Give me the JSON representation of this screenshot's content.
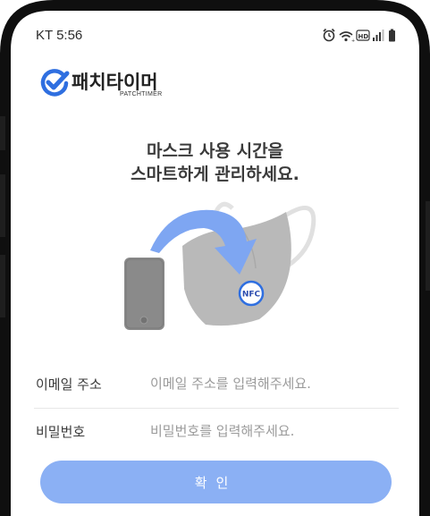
{
  "status_bar": {
    "time": "KT 5:56",
    "icons": [
      "alarm-icon",
      "wifi-icon",
      "hd-icon",
      "signal-icon",
      "battery-icon"
    ],
    "hd_text": "HD"
  },
  "brand": {
    "name": "패치타이머",
    "subtitle": "PATCHTIMER",
    "accent_color": "#2f6fe0"
  },
  "headline": {
    "line1": "마스크 사용 시간을",
    "line2": "스마트하게 관리하세요."
  },
  "illustration": {
    "nfc_label": "NFC",
    "arrow_color": "#7ea6f2",
    "mask_color": "#b9b9b9",
    "phone_color": "#8a8a8a"
  },
  "form": {
    "email": {
      "label": "이메일 주소",
      "placeholder": "이메일 주소를 입력해주세요."
    },
    "password": {
      "label": "비밀번호",
      "placeholder": "비밀번호를 입력해주세요."
    }
  },
  "confirm_button": {
    "label": "확인",
    "color": "#8bb0f4"
  }
}
